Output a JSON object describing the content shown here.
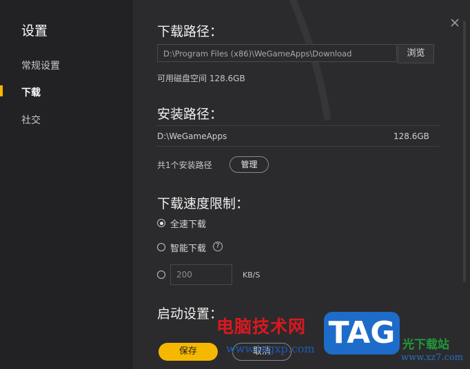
{
  "sidebar": {
    "title": "设置",
    "items": [
      {
        "label": "常规设置",
        "active": false
      },
      {
        "label": "下载",
        "active": true
      },
      {
        "label": "社交",
        "active": false
      }
    ]
  },
  "download_path": {
    "title": "下载路径：",
    "path": "D:\\Program Files (x86)\\WeGameApps\\Download",
    "browse_label": "浏览",
    "free_space": "可用磁盘空间 128.6GB"
  },
  "install_path": {
    "title": "安装路径：",
    "path": "D:\\WeGameApps",
    "size": "128.6GB",
    "count_text": "共1个安装路径",
    "manage_label": "管理"
  },
  "speed_limit": {
    "title": "下载速度限制：",
    "options": [
      {
        "label": "全速下载",
        "checked": true
      },
      {
        "label": "智能下载",
        "checked": false,
        "help": "?"
      }
    ],
    "custom_value": "200",
    "unit": "KB/S"
  },
  "startup": {
    "title": "启动设置："
  },
  "footer": {
    "save_label": "保存",
    "cancel_label": "取消"
  },
  "watermark": {
    "text": "电脑技术网",
    "url": "www.tagxp.com",
    "tag": "TAG",
    "right_text": "光下载站",
    "right_url": "www.xz7.com"
  },
  "colors": {
    "accent": "#f5b800",
    "background": "#2b2b2d",
    "sidebar": "#222224"
  }
}
